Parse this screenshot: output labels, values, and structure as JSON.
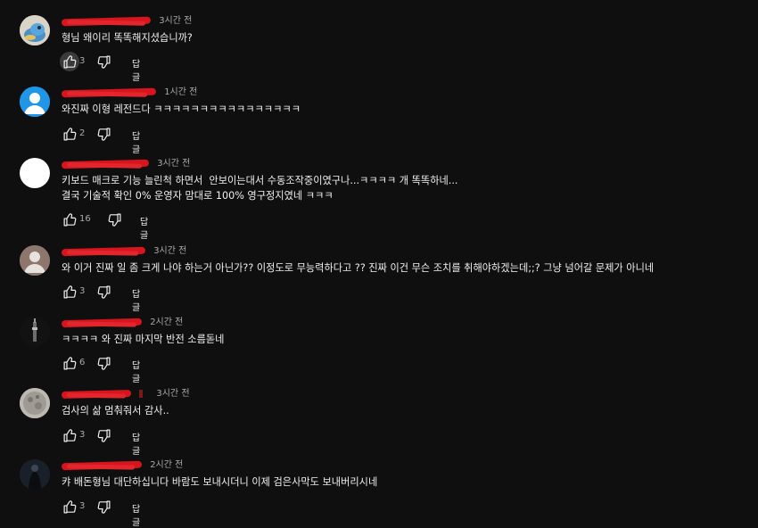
{
  "colors": {
    "background": "#0f0f0f",
    "text": "#f1f1f1",
    "secondary": "#aaaaaa",
    "redaction": "#d8141d"
  },
  "comments": [
    {
      "time": "3시간 전",
      "text": "형님 왜이리 똑똑해지셨습니까?",
      "likes": "3",
      "reply": "답글",
      "avatar": "cartoon-avatar"
    },
    {
      "time": "1시간 전",
      "text": "와진짜 이형 레전드다 ㅋㅋㅋㅋㅋㅋㅋㅋㅋㅋㅋㅋㅋㅋㅋㅋ",
      "likes": "2",
      "reply": "답글",
      "avatar": "default-person-avatar"
    },
    {
      "time": "3시간 전",
      "text": "키보드 매크로 기능 늘린척 하면서  안보이는대서 수동조작중이였구나...ㅋㅋㅋㅋ 개 똑똑하네...\n결국 기술적 확인 0% 운영자 맘대로 100% 영구정지였네 ㅋㅋㅋ",
      "likes": "16",
      "reply": "답글",
      "avatar": "white-avatar"
    },
    {
      "time": "3시간 전",
      "text": "와 이거 진짜 일 좀 크게 나야 하는거 아닌가?? 이정도로 무능력하다고 ?? 진짜 이건 무슨 조치를 취해야하겠는데;;? 그냥 넘어갈 문제가 아니네",
      "likes": "3",
      "reply": "답글",
      "avatar": "gray-person-avatar"
    },
    {
      "time": "2시간 전",
      "text": "ㅋㅋㅋㅋ 와 진짜 마지막 반전 소름돋네",
      "likes": "6",
      "reply": "답글",
      "avatar": "tower-photo-avatar"
    },
    {
      "time": "3시간 전",
      "text": "검사의 삶 멈춰줘서 감사..",
      "likes": "3",
      "reply": "답글",
      "avatar": "moon-photo-avatar"
    },
    {
      "time": "2시간 전",
      "text": "캬 배돈형님 대단하십니다 바람도 보내시더니 이제 검은사막도 보내버리시네",
      "likes": "3",
      "reply": "답글",
      "avatar": "dark-figure-avatar"
    }
  ]
}
